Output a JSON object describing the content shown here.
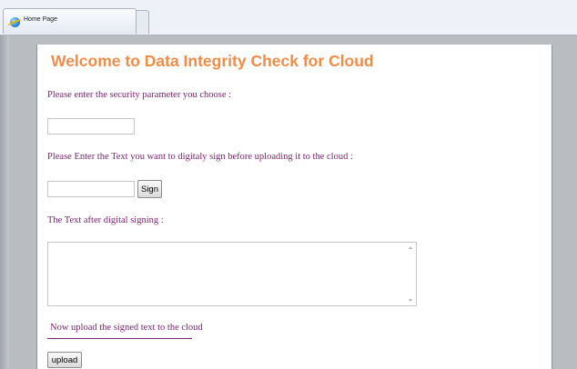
{
  "browser": {
    "tab_title": "Home Page",
    "tab_icon": "ie-browser-icon"
  },
  "page": {
    "title": "Welcome to Data  Integrity Check for Cloud",
    "security_param_label": "Please enter the security parameter you choose :",
    "security_param_value": "",
    "text_to_sign_label": "Please Enter the Text you want to digitaly sign before uploading it to the cloud :",
    "text_to_sign_value": "",
    "sign_button_label": "Sign",
    "signed_text_label": "The Text after digital signing :",
    "signed_text_value": "",
    "upload_prompt": "Now upload the signed text to the cloud",
    "upload_button_label": "upload"
  },
  "colors": {
    "title": "#f08c45",
    "label": "#7a1f6e",
    "frame": "#b9bcc1"
  }
}
